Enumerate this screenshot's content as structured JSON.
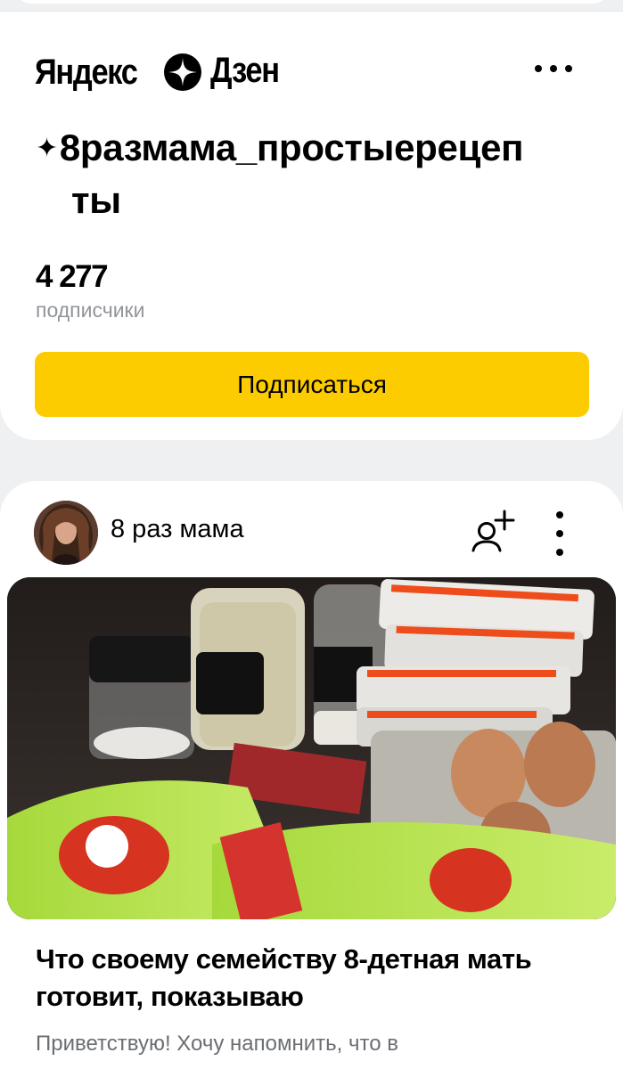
{
  "header": {
    "logo_word_1": "Яндекс",
    "logo_word_2": "Дзен",
    "logo_icon": "zen-star-icon",
    "more_icon": "more-horizontal-icon"
  },
  "channel": {
    "title_line_1": "8размама_простыерецеп",
    "title_line_2": "ты",
    "subscriber_count": "4 277",
    "subscriber_label": "подписчики",
    "subscribe_label": "Подписаться"
  },
  "post": {
    "author_name": "8 раз мама",
    "follow_icon": "add-person-icon",
    "more_icon": "more-vertical-icon",
    "title": "Что своему семейству 8-детная мать готовит, показываю",
    "excerpt": "Приветствую!   Хочу напомнить, что в"
  },
  "colors": {
    "accent_yellow": "#fdcc00",
    "background": "#eff0f2",
    "muted_text": "#919499"
  }
}
